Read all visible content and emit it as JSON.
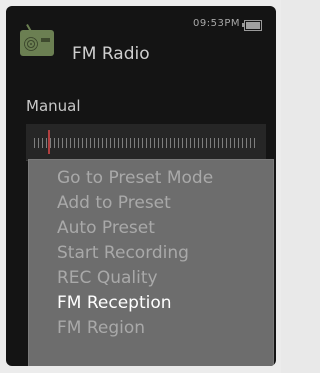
{
  "status": {
    "time": "09:53PM"
  },
  "header": {
    "title": "FM Radio"
  },
  "tuner": {
    "mode": "Manual"
  },
  "menu": {
    "items": [
      {
        "label": "Go to Preset Mode",
        "selected": false
      },
      {
        "label": "Add to Preset",
        "selected": false
      },
      {
        "label": "Auto Preset",
        "selected": false
      },
      {
        "label": "Start Recording",
        "selected": false
      },
      {
        "label": "REC Quality",
        "selected": false
      },
      {
        "label": "FM Reception",
        "selected": true
      },
      {
        "label": "FM Region",
        "selected": false
      }
    ]
  },
  "colors": {
    "screen_bg": "#141414",
    "menu_bg": "#6d6d6d",
    "menu_text": "#a9a9a9",
    "menu_selected_text": "#ffffff",
    "icon_green": "#6b7f52"
  },
  "icons": {
    "app_icon": "radio-icon",
    "battery": "battery-icon"
  }
}
